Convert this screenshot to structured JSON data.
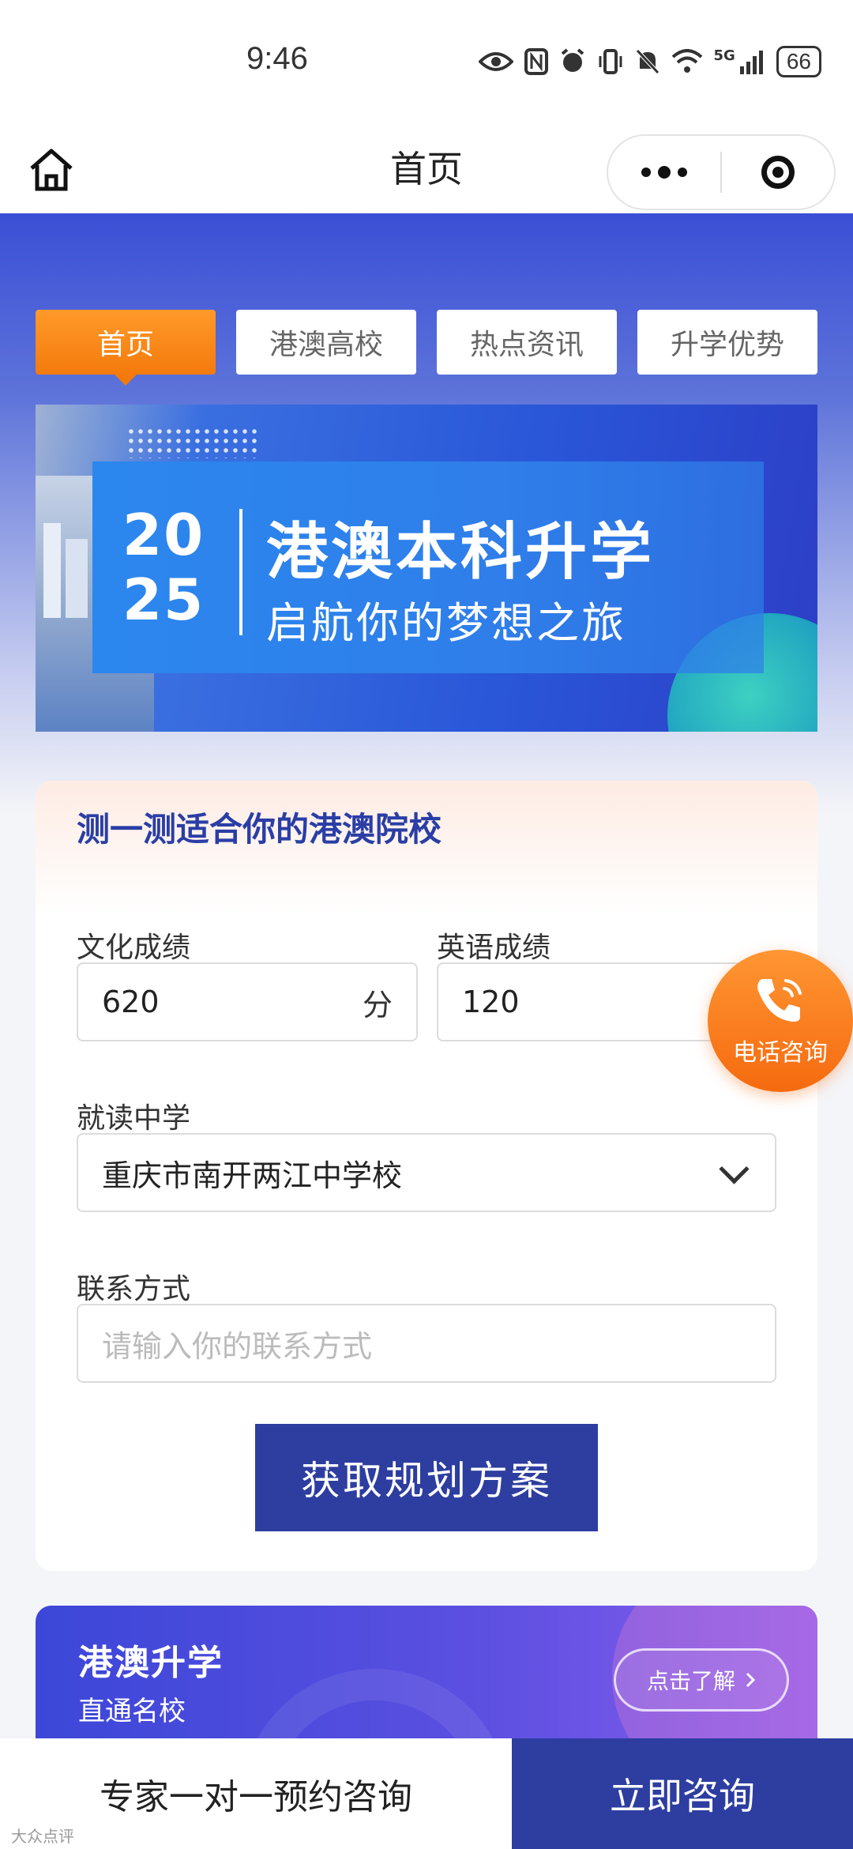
{
  "status_bar": {
    "time": "9:46",
    "network": "5G",
    "battery": "66",
    "icons": [
      "eye-icon",
      "nfc-icon",
      "alarm-icon",
      "vibrate-icon",
      "mute-icon",
      "wifi-icon",
      "signal-icon",
      "battery-icon"
    ]
  },
  "navbar": {
    "title": "首页",
    "icons": [
      "home-icon",
      "more-icon",
      "close-mini-program-icon"
    ]
  },
  "tabs": [
    {
      "label": "首页",
      "active": true
    },
    {
      "label": "港澳高校",
      "active": false
    },
    {
      "label": "热点资讯",
      "active": false
    },
    {
      "label": "升学优势",
      "active": false
    }
  ],
  "banner": {
    "year_top": "20",
    "year_bottom": "25",
    "title": "港澳本科升学",
    "subtitle": "启航你的梦想之旅"
  },
  "form": {
    "title": "测一测适合你的港澳院校",
    "score_label": "文化成绩",
    "score_value": "620",
    "score_unit": "分",
    "english_label": "英语成绩",
    "english_value": "120",
    "school_label": "就读中学",
    "school_value": "重庆市南开两江中学校",
    "contact_label": "联系方式",
    "contact_placeholder": "请输入你的联系方式",
    "submit_label": "获取规划方案"
  },
  "float_phone": {
    "label": "电话咨询",
    "icon": "phone-icon"
  },
  "promo": {
    "title": "港澳升学",
    "subtitle": "直通名校",
    "button_label": "点击了解"
  },
  "bottom_bar": {
    "left_label": "专家一对一预约咨询",
    "right_label": "立即咨询"
  },
  "watermark": "大众点评",
  "colors": {
    "accent_orange": "#f47a0c",
    "brand_blue": "#2d3da0",
    "title_blue": "#2a3ea6"
  }
}
